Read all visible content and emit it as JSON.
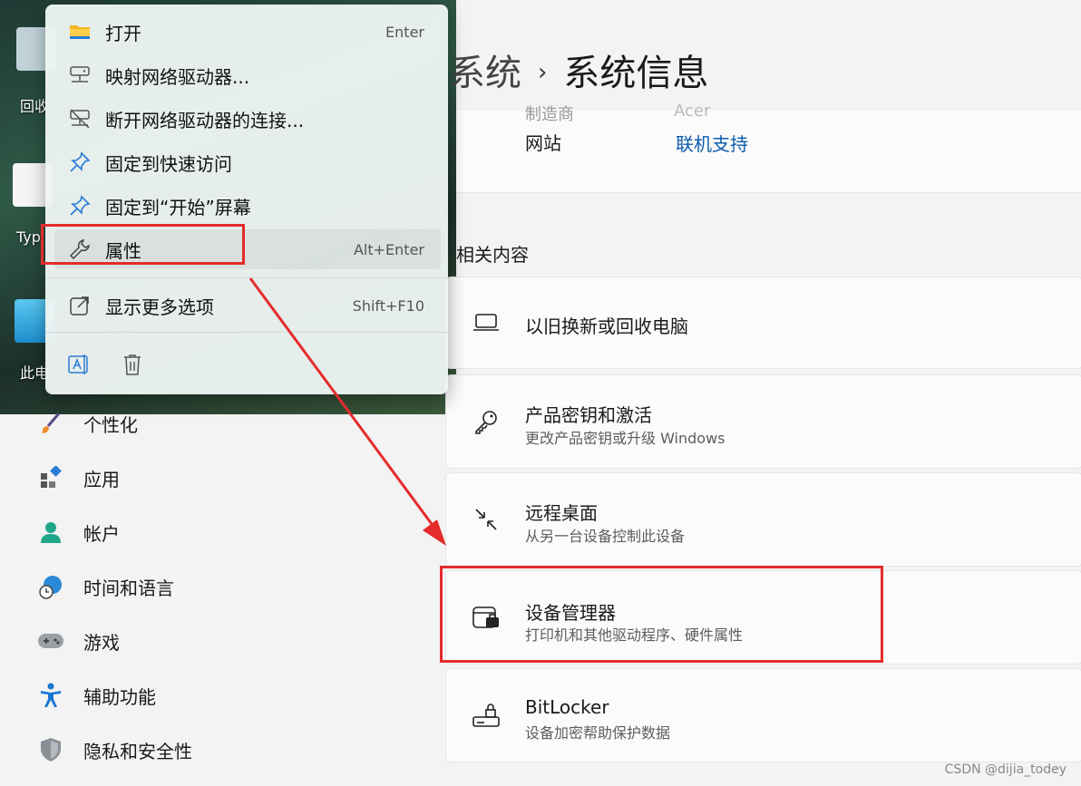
{
  "header": {
    "crumb_parent": "系统",
    "crumb_sep": "›",
    "crumb_current": "系统信息"
  },
  "top_card": {
    "cut_key": "制造商",
    "cut_value": "Acer",
    "website_label": "网站",
    "website_link": "联机支持"
  },
  "section": {
    "title": "相关内容"
  },
  "cards": [
    {
      "title": "以旧换新或回收电脑",
      "subtitle": "",
      "icon": "laptop-icon"
    },
    {
      "title": "产品密钥和激活",
      "subtitle": "更改产品密钥或升级 Windows",
      "icon": "key-icon"
    },
    {
      "title": "远程桌面",
      "subtitle": "从另一台设备控制此设备",
      "icon": "remote-desktop-icon"
    },
    {
      "title": "设备管理器",
      "subtitle": "打印机和其他驱动程序、硬件属性",
      "icon": "device-manager-icon"
    },
    {
      "title": "BitLocker",
      "subtitle": "设备加密帮助保护数据",
      "icon": "bitlocker-icon"
    }
  ],
  "sidebar": {
    "items": [
      {
        "label": "个性化",
        "icon": "brush-icon"
      },
      {
        "label": "应用",
        "icon": "apps-icon"
      },
      {
        "label": "帐户",
        "icon": "account-icon"
      },
      {
        "label": "时间和语言",
        "icon": "globe-clock-icon"
      },
      {
        "label": "游戏",
        "icon": "gamepad-icon"
      },
      {
        "label": "辅助功能",
        "icon": "accessibility-icon"
      },
      {
        "label": "隐私和安全性",
        "icon": "shield-icon"
      }
    ]
  },
  "desktop": {
    "labels": [
      "回收",
      "Typ",
      "此电"
    ]
  },
  "context_menu": {
    "items": [
      {
        "label": "打开",
        "shortcut": "Enter",
        "icon": "folder-icon"
      },
      {
        "label": "映射网络驱动器...",
        "shortcut": "",
        "icon": "network-drive-icon"
      },
      {
        "label": "断开网络驱动器的连接...",
        "shortcut": "",
        "icon": "disconnect-drive-icon"
      },
      {
        "label": "固定到快速访问",
        "shortcut": "",
        "icon": "pin-icon"
      },
      {
        "label": "固定到“开始”屏幕",
        "shortcut": "",
        "icon": "pin-icon"
      },
      {
        "label": "属性",
        "shortcut": "Alt+Enter",
        "icon": "wrench-icon"
      },
      {
        "label": "显示更多选项",
        "shortcut": "Shift+F10",
        "icon": "share-icon"
      }
    ],
    "bottom_icons": [
      "rename-icon",
      "delete-icon"
    ]
  },
  "watermark": "CSDN @dijia_todey",
  "colors": {
    "accent": "#0b5cad",
    "highlight_red": "#e52b2b",
    "menu_icon_blue": "#2a7bd4"
  }
}
